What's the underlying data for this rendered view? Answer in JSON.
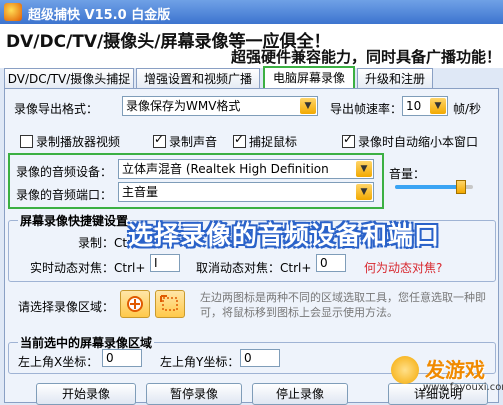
{
  "titlebar": {
    "title": "超级捕快 V15.0 白金版"
  },
  "banner": {
    "line1": "DV/DC/TV/摄像头/屏幕录像等一应俱全！",
    "line2": "超强硬件兼容能力，同时具备广播功能！"
  },
  "tabs": [
    {
      "label": "DV/DC/TV/摄像头捕捉",
      "active": false
    },
    {
      "label": "增强设置和视频广播",
      "active": false
    },
    {
      "label": "电脑屏幕录像",
      "active": true
    },
    {
      "label": "升级和注册",
      "active": false
    }
  ],
  "export": {
    "format_label": "录像导出格式：",
    "format_value": "录像保存为WMV格式",
    "fps_label": "导出帧速率：",
    "fps_value": "10",
    "fps_unit": "帧/秒"
  },
  "checks": [
    {
      "label": "录制播放器视频",
      "checked": false
    },
    {
      "label": "录制声音",
      "checked": true
    },
    {
      "label": "捕捉鼠标",
      "checked": true
    },
    {
      "label": "录像时自动缩小本窗口",
      "checked": true
    }
  ],
  "audio": {
    "device_label": "录像的音频设备：",
    "device_value": "立体声混音 (Realtek High Definition",
    "port_label": "录像的音频端口：",
    "port_value": "主音量",
    "volume_label": "音量：",
    "volume_level": 0.85
  },
  "hotkeys": {
    "group_title": "屏幕录像快捷键设置",
    "record_label": "录制：Ctrl+",
    "live_focus_label": "实时动态对焦：Ctrl+",
    "live_focus_value": "I",
    "cancel_focus_label": "取消动态对焦：Ctrl+",
    "cancel_focus_value": "0",
    "help_link": "何为动态对焦?"
  },
  "overlay_caption": "选择录像的音频设备和端口",
  "region": {
    "label": "请选择录像区域：",
    "hint": "左边两图标是两种不同的区域选取工具，您任意选取一种即可，将鼠标移到图标上会显示使用方法。"
  },
  "current_region": {
    "group_title": "当前选中的屏幕录像区域",
    "x_label": "左上角X坐标：",
    "x_value": "0",
    "y_label": "左上角Y坐标：",
    "y_value": "0"
  },
  "buttons": {
    "start": "开始录像",
    "pause": "暂停录像",
    "stop": "停止录像",
    "help": "详细说明"
  },
  "watermark": {
    "text": "发游戏",
    "url": "www.fayouxi.com"
  },
  "colors": {
    "highlight": "#3cb043",
    "title_blue": "#3d74cf",
    "link_red": "#d8282f",
    "overlay_blue": "#2a62c9"
  }
}
